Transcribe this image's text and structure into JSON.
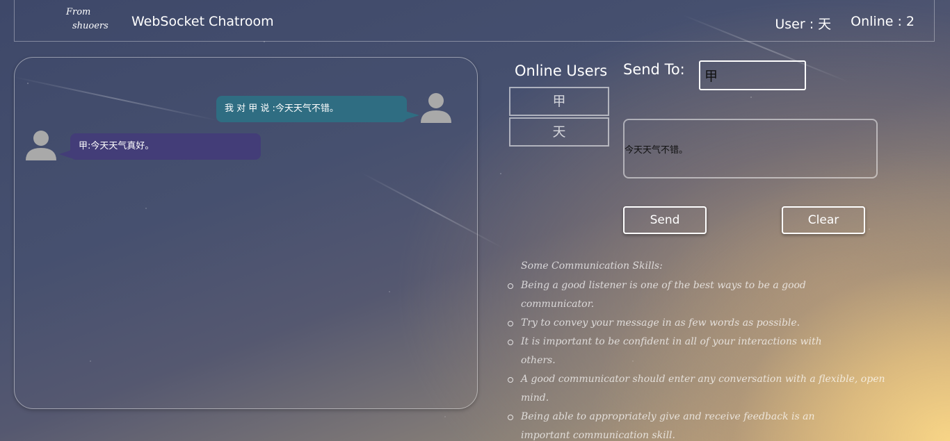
{
  "header": {
    "logo_line1": "From",
    "logo_line2": "shuoers",
    "title": "WebSocket Chatroom",
    "user_label": "User : 天",
    "online_label": "Online :  2"
  },
  "chat": {
    "messages": [
      {
        "direction": "outgoing",
        "text": "我 对 甲 说 :今天天气不错。",
        "avatar": "user-avatar-icon"
      },
      {
        "direction": "incoming",
        "text": "甲:今天天气真好。",
        "avatar": "user-avatar-icon"
      }
    ]
  },
  "online_users": {
    "title": "Online Users",
    "users": [
      "甲",
      "天"
    ]
  },
  "compose": {
    "send_to_label": "Send To:",
    "send_to_value": "甲",
    "message_value": "今天天气不错。",
    "send_label": "Send",
    "clear_label": "Clear"
  },
  "tips": {
    "title": "Some Communication Skills:",
    "items": [
      "Being a good listener is one of the best ways to be a good communicator.",
      "Try to convey your message in as few words as possible.",
      "It is important to be confident in all of your interactions with others.",
      "A good communicator should enter any conversation with a flexible, open mind.",
      "Being able to appropriately give and receive feedback is an important communication skill."
    ]
  },
  "colors": {
    "outgoing_bubble": "#2f6d82",
    "incoming_bubble": "#433d78",
    "avatar": "#a9a9a9"
  }
}
